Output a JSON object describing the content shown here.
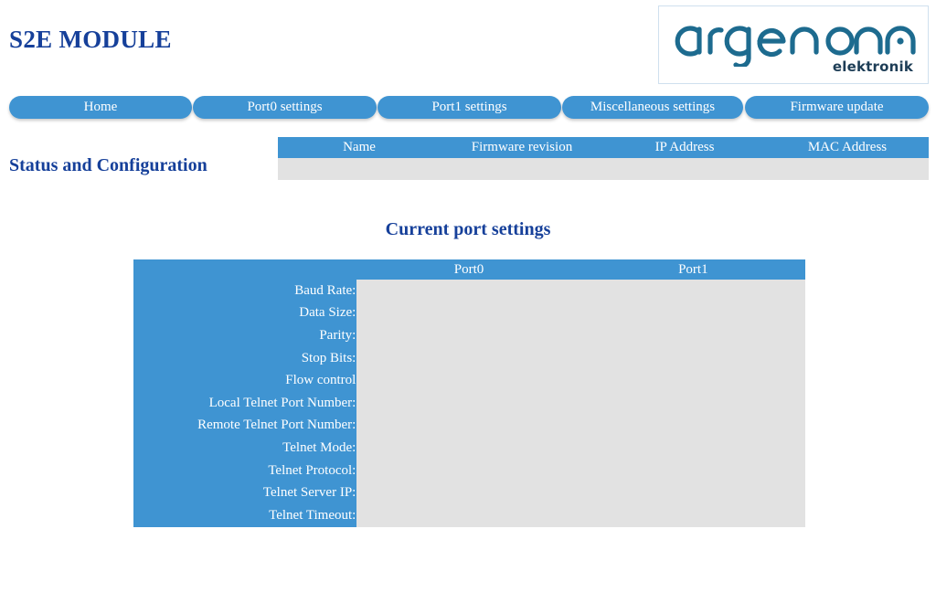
{
  "header": {
    "title": "S2E MODULE",
    "logo": {
      "wordmark": "argenom",
      "subtitle": "elektronik",
      "mark_color": "#1d6b8f",
      "subtitle_color": "#1d3d56"
    }
  },
  "nav": {
    "items": [
      {
        "label": "Home",
        "name": "nav-home"
      },
      {
        "label": "Port0 settings",
        "name": "nav-port0-settings"
      },
      {
        "label": "Port1 settings",
        "name": "nav-port1-settings"
      },
      {
        "label": "Miscellaneous settings",
        "name": "nav-miscellaneous-settings"
      },
      {
        "label": "Firmware update",
        "name": "nav-firmware-update"
      }
    ]
  },
  "status_section": {
    "heading": "Status and Configuration",
    "table": {
      "columns": [
        "Name",
        "Firmware revision",
        "IP Address",
        "MAC Address"
      ],
      "rows": [
        {
          "Name": "",
          "Firmware revision": "",
          "IP Address": "",
          "MAC Address": ""
        }
      ]
    }
  },
  "ports_section": {
    "heading": "Current port settings",
    "table": {
      "columns": [
        "",
        "Port0",
        "Port1"
      ],
      "rows": [
        {
          "label": "Baud Rate:",
          "port0": "",
          "port1": ""
        },
        {
          "label": "Data Size:",
          "port0": "",
          "port1": ""
        },
        {
          "label": "Parity:",
          "port0": "",
          "port1": ""
        },
        {
          "label": "Stop Bits:",
          "port0": "",
          "port1": ""
        },
        {
          "label": "Flow control",
          "port0": "",
          "port1": ""
        },
        {
          "label": "Local Telnet Port Number:",
          "port0": "",
          "port1": ""
        },
        {
          "label": "Remote Telnet Port Number:",
          "port0": "",
          "port1": ""
        },
        {
          "label": "Telnet Mode:",
          "port0": "",
          "port1": ""
        },
        {
          "label": "Telnet Protocol:",
          "port0": "",
          "port1": ""
        },
        {
          "label": "Telnet Server IP:",
          "port0": "",
          "port1": ""
        },
        {
          "label": "Telnet Timeout:",
          "port0": "",
          "port1": ""
        }
      ]
    }
  },
  "colors": {
    "accent_blue": "#3f94d2",
    "heading_navy": "#16409a",
    "data_gray": "#e2e2e2",
    "logo_teal": "#1d6b8f"
  }
}
